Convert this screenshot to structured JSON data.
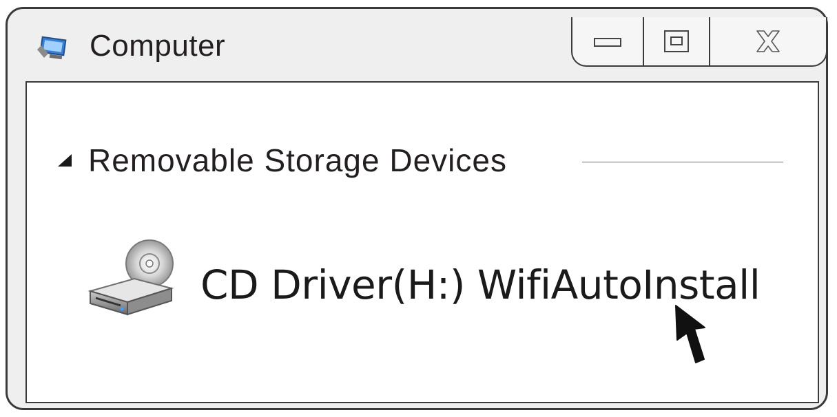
{
  "window": {
    "title": "Computer",
    "icon": "computer-icon",
    "controls": {
      "minimize_icon": "minimize-icon",
      "maximize_icon": "restore-icon",
      "close_icon": "close-icon"
    }
  },
  "content": {
    "group": {
      "label": "Removable Storage Devices",
      "expand_icon": "triangle-expanded-icon"
    },
    "drive": {
      "label": "CD Driver(H:) WifiAutoInstall",
      "icon": "cd-drive-icon"
    }
  },
  "pointer": {
    "icon": "mouse-cursor-icon"
  }
}
